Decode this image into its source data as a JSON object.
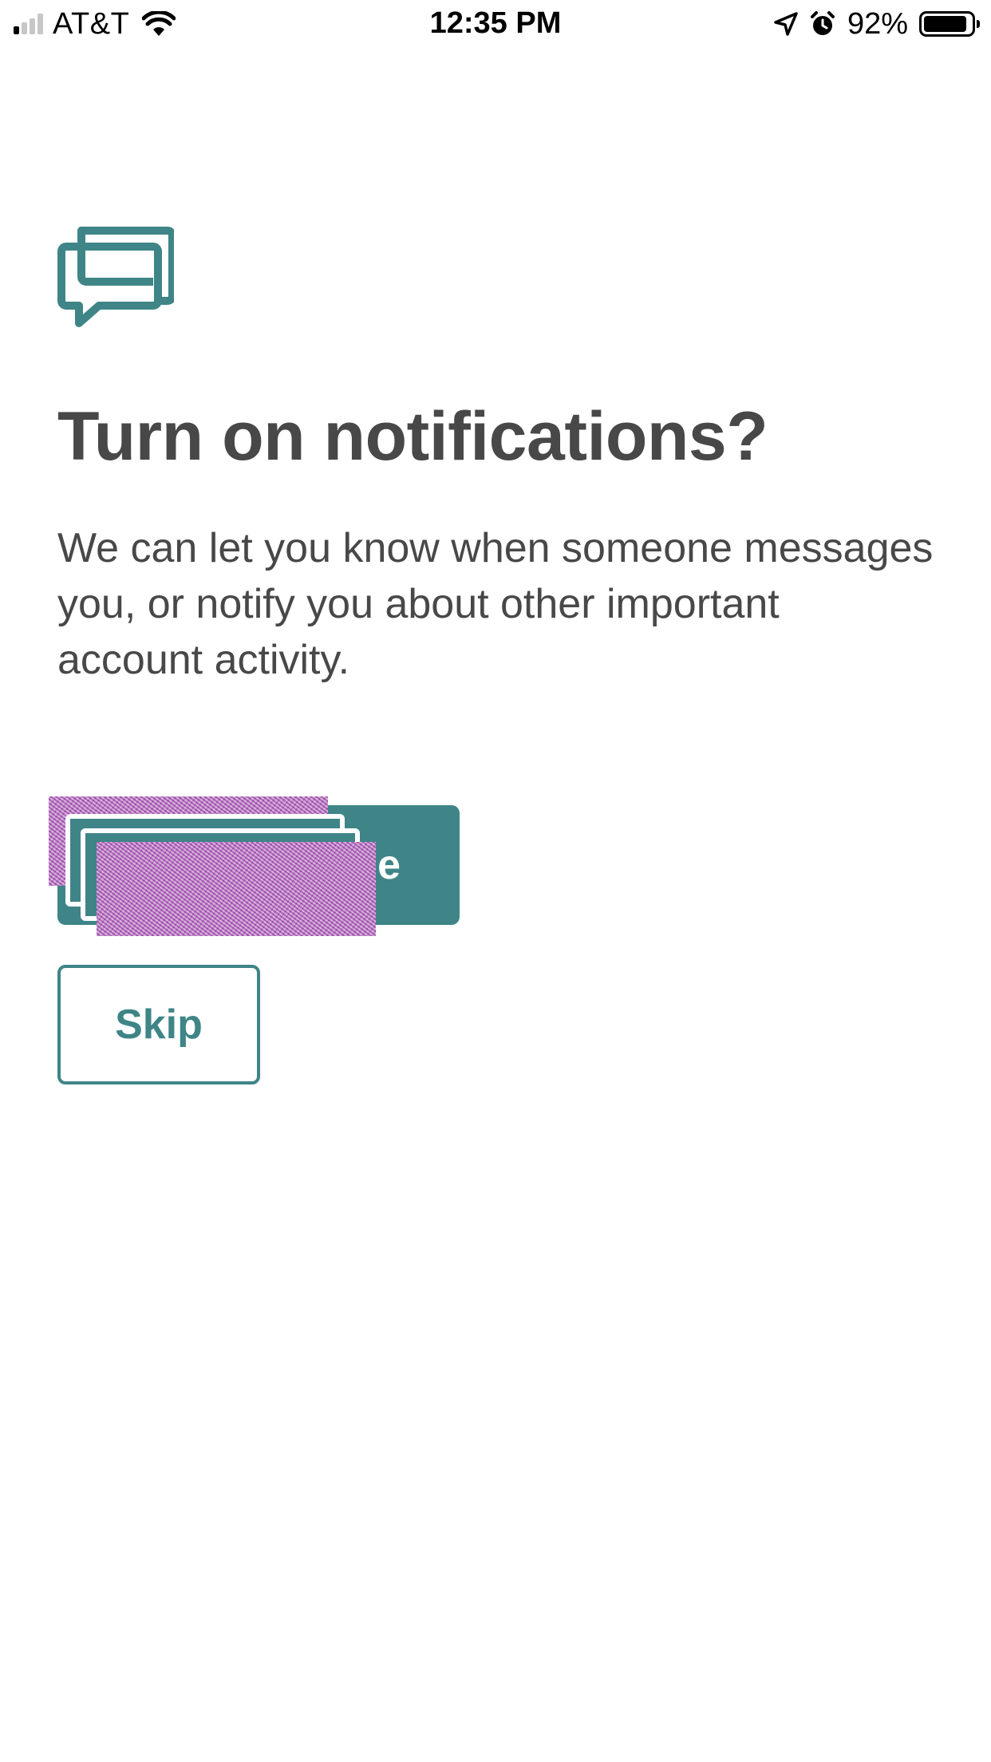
{
  "status_bar": {
    "carrier": "AT&T",
    "time": "12:35 PM",
    "battery_percent": "92%",
    "battery_level": 0.92,
    "signal_bars": 1,
    "signal_bars_total": 4,
    "icons": [
      "signal-icon",
      "wifi-icon",
      "location-arrow-icon",
      "alarm-icon",
      "battery-icon"
    ]
  },
  "prompt": {
    "icon": "chat-bubbles-icon",
    "title": "Turn on notifications?",
    "description": "We can let you know when someone messages you, or notify you about other important account activity."
  },
  "actions": {
    "primary_label": "e",
    "secondary_label": "Skip"
  },
  "colors": {
    "accent": "#3f8587",
    "text": "#484848",
    "background": "#ffffff"
  }
}
